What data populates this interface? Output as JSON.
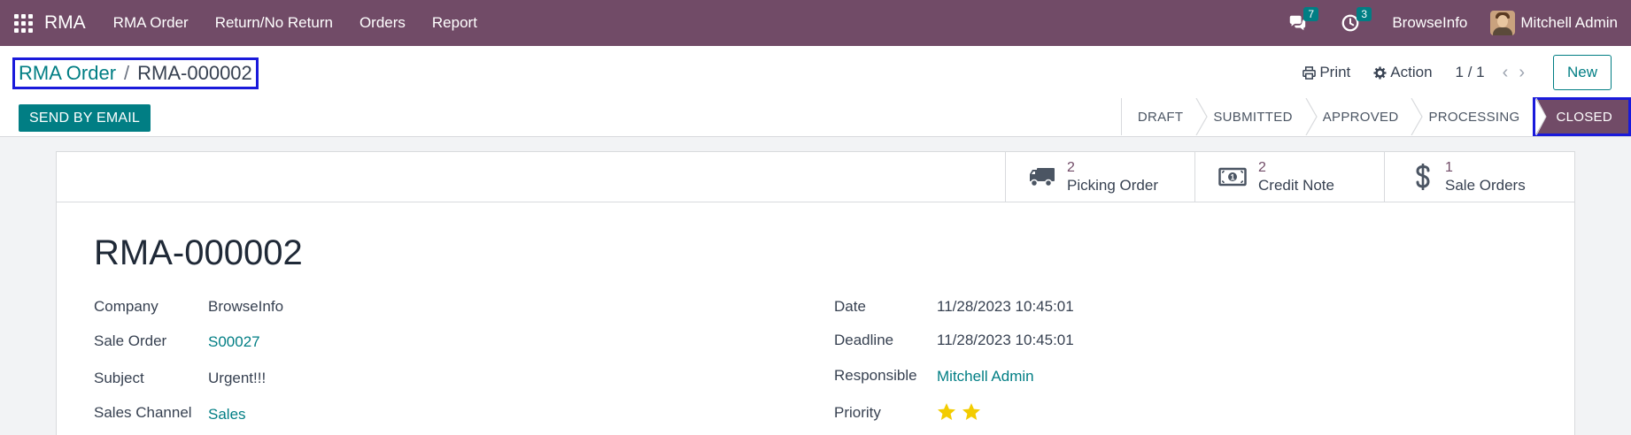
{
  "navbar": {
    "app_name": "RMA",
    "menu": [
      "RMA Order",
      "Return/No Return",
      "Orders",
      "Report"
    ],
    "messages_count": "7",
    "activities_count": "3",
    "company": "BrowseInfo",
    "user": "Mitchell Admin",
    "bg_color": "#714b67"
  },
  "breadcrumb": {
    "parent": "RMA Order",
    "separator": "/",
    "current": "RMA-000002"
  },
  "control": {
    "print_label": "Print",
    "action_label": "Action",
    "pager": "1 / 1",
    "new_label": "New",
    "send_email_label": "SEND BY EMAIL"
  },
  "statusbar": {
    "stages": [
      "DRAFT",
      "SUBMITTED",
      "APPROVED",
      "PROCESSING",
      "CLOSED"
    ],
    "active": "CLOSED"
  },
  "smart_buttons": [
    {
      "count": "2",
      "label": "Picking Order",
      "icon": "truck-icon"
    },
    {
      "count": "2",
      "label": "Credit Note",
      "icon": "money-icon"
    },
    {
      "count": "1",
      "label": "Sale Orders",
      "icon": "dollar-icon"
    }
  ],
  "record": {
    "title": "RMA-000002",
    "left_fields": [
      {
        "label": "Company",
        "value": "BrowseInfo"
      },
      {
        "label": "Sale Order",
        "value": "S00027"
      },
      {
        "label": "Subject",
        "value": "Urgent!!!"
      },
      {
        "label": "Sales Channel",
        "value": "Sales"
      }
    ],
    "right_fields": [
      {
        "label": "Date",
        "value": "11/28/2023 10:45:01"
      },
      {
        "label": "Deadline",
        "value": "11/28/2023 10:45:01"
      },
      {
        "label": "Responsible",
        "value": "Mitchell Admin"
      },
      {
        "label": "Priority",
        "value": 2,
        "max": 2
      }
    ]
  },
  "colors": {
    "accent": "#017e84",
    "brand": "#714b67",
    "star": "#f3cc00"
  }
}
